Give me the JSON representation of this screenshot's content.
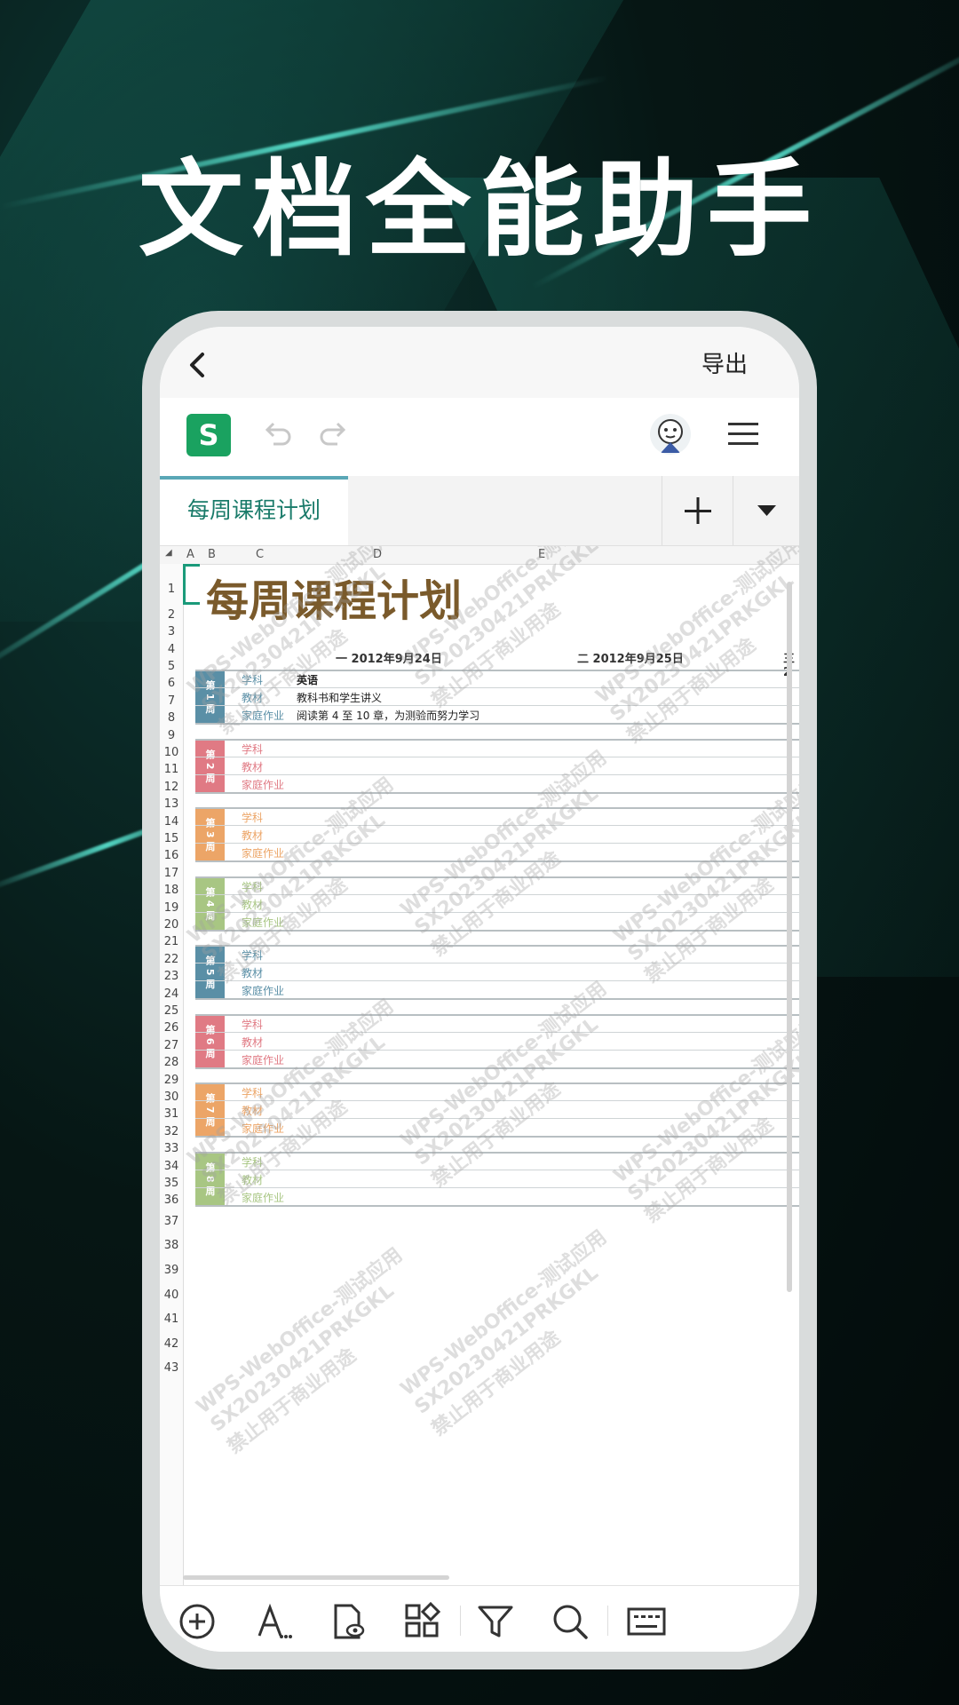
{
  "headline": "文档全能助手",
  "topbar": {
    "export_label": "导出"
  },
  "toolbar": {
    "app_letter": "S"
  },
  "tabs": {
    "sheet_name": "每周课程计划"
  },
  "grid": {
    "columns": [
      "A",
      "B",
      "C",
      "D",
      "E"
    ],
    "rows": [
      "1",
      "2",
      "3",
      "4",
      "5",
      "6",
      "7",
      "8",
      "9",
      "10",
      "11",
      "12",
      "13",
      "14",
      "15",
      "16",
      "17",
      "18",
      "19",
      "20",
      "21",
      "22",
      "23",
      "24",
      "25",
      "26",
      "27",
      "28",
      "29",
      "30",
      "31",
      "32",
      "33",
      "34",
      "35",
      "36",
      "37",
      "38",
      "39",
      "40",
      "41",
      "42",
      "43"
    ],
    "title": "每周课程计划",
    "date_mon": "一 2012年9月24日",
    "date_tue": "二 2012年9月25日",
    "date_wed_partial": "三 2",
    "labels": {
      "subject": "学科",
      "material": "教材",
      "homework": "家庭作业"
    },
    "week1_values": {
      "subject": "英语",
      "material": "教科书和学生讲义",
      "homework": "阅读第 4 至 10 章，为测验而努力学习"
    },
    "weeks": [
      {
        "label": "第 1 周",
        "color": "#5a8fa6"
      },
      {
        "label": "第 2 周",
        "color": "#e07a84"
      },
      {
        "label": "第 3 周",
        "color": "#eca567"
      },
      {
        "label": "第 4 周",
        "color": "#a8c683"
      },
      {
        "label": "第 5 周",
        "color": "#5a8fa6"
      },
      {
        "label": "第 6 周",
        "color": "#e07a84"
      },
      {
        "label": "第 7 周",
        "color": "#eca567"
      },
      {
        "label": "第 8 周",
        "color": "#a8c683"
      }
    ],
    "watermark_lines": [
      "WPS-WebOffice-测试应用",
      "SX20230421PRKGKL",
      "禁止用于商业用途"
    ]
  },
  "colors": {
    "accent": "#1a9a7a",
    "title_brown": "#7a5a2b",
    "app_green": "#1aa260"
  }
}
